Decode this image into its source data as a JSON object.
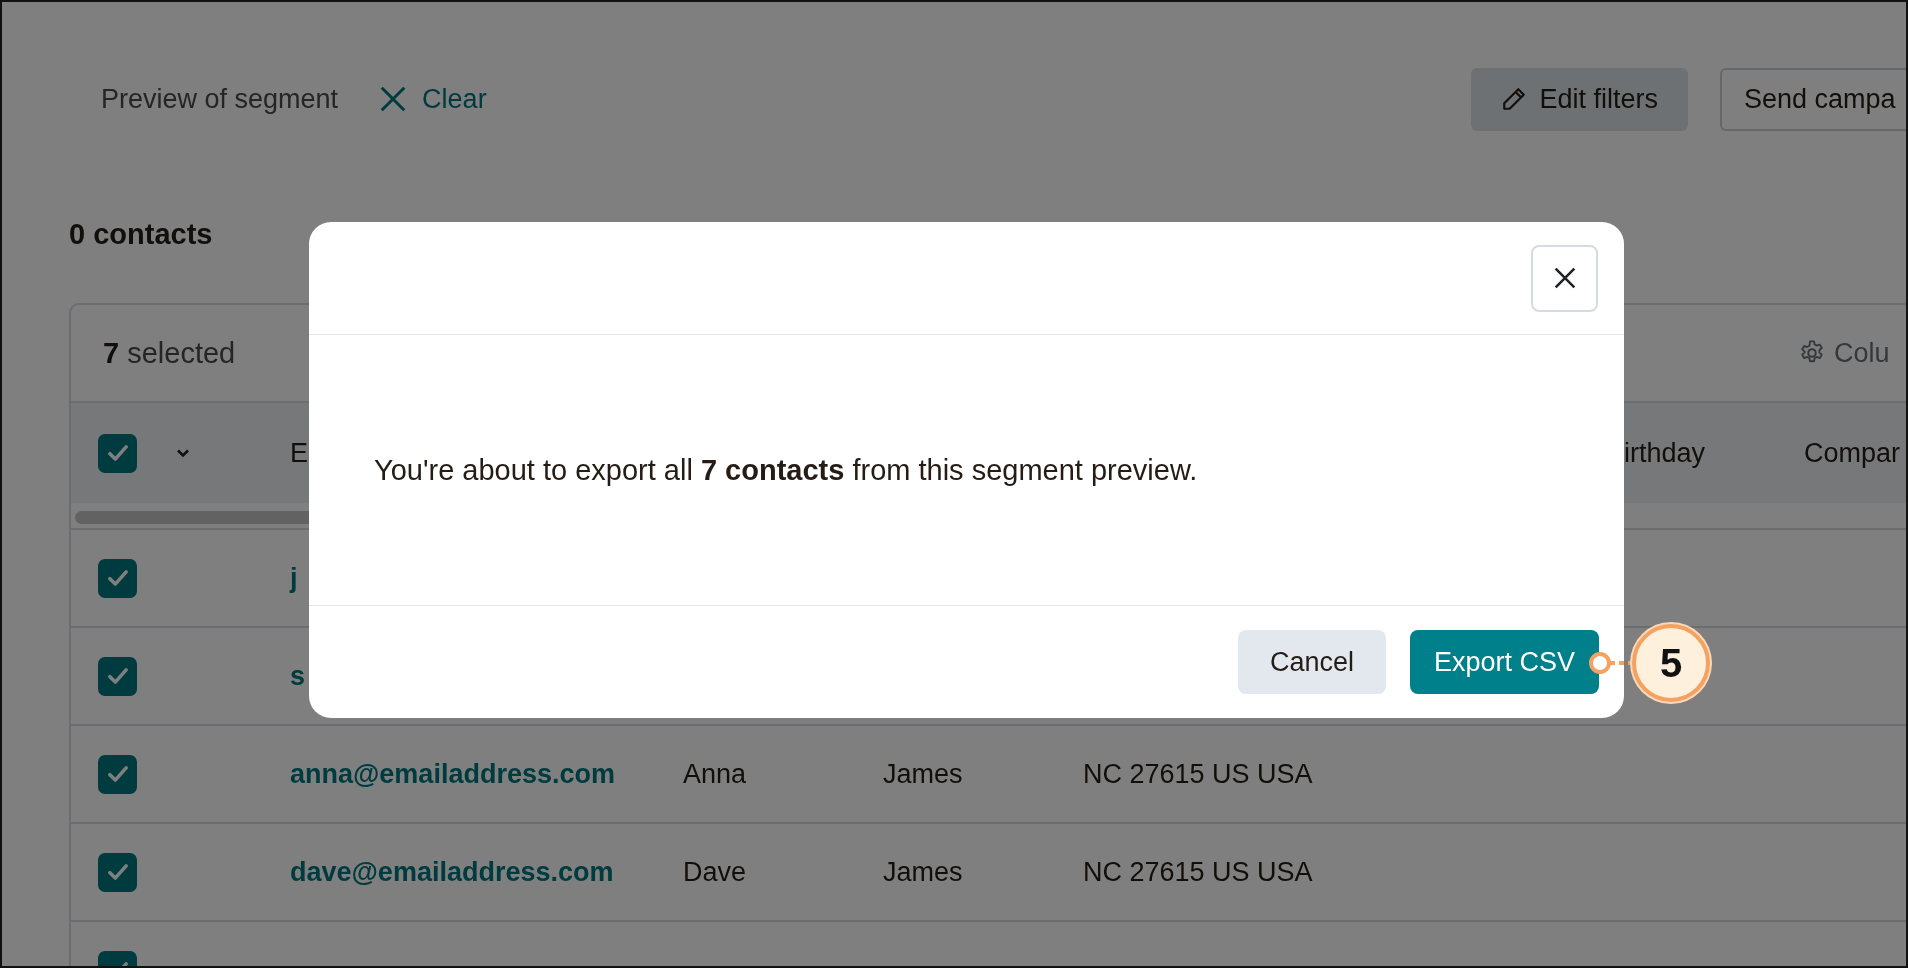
{
  "header": {
    "title": "Preview of segment",
    "clear_button": "Clear",
    "buttons": [
      {
        "label": "Edit filters",
        "kind": "filled"
      },
      {
        "label": "Send campa",
        "kind": "outline"
      }
    ]
  },
  "count": "0 contacts",
  "table": {
    "selection": {
      "count": "7",
      "label": "selected"
    },
    "columns_button": "Colu",
    "select_all_checked": true,
    "columns": {
      "email": "E",
      "birthday": "irthday",
      "company": "Compar"
    },
    "rows": [
      {
        "checked": true,
        "email": "j"
      },
      {
        "checked": true,
        "email": "s"
      },
      {
        "checked": true,
        "email": "anna@emailaddress.com",
        "first_name": "Anna",
        "last_name": "James",
        "address": "NC 27615 US USA"
      },
      {
        "checked": true,
        "email": "dave@emailaddress.com",
        "first_name": "Dave",
        "last_name": "James",
        "address": "NC 27615 US USA"
      },
      {
        "checked": true
      }
    ]
  },
  "dialog": {
    "message": "You're about to export all **7 contacts** from this segment preview.",
    "buttons": [
      {
        "label": "Cancel",
        "kind": "secondary"
      },
      {
        "label": "Export CSV",
        "kind": "primary"
      }
    ]
  },
  "callout": {
    "label": "5"
  }
}
